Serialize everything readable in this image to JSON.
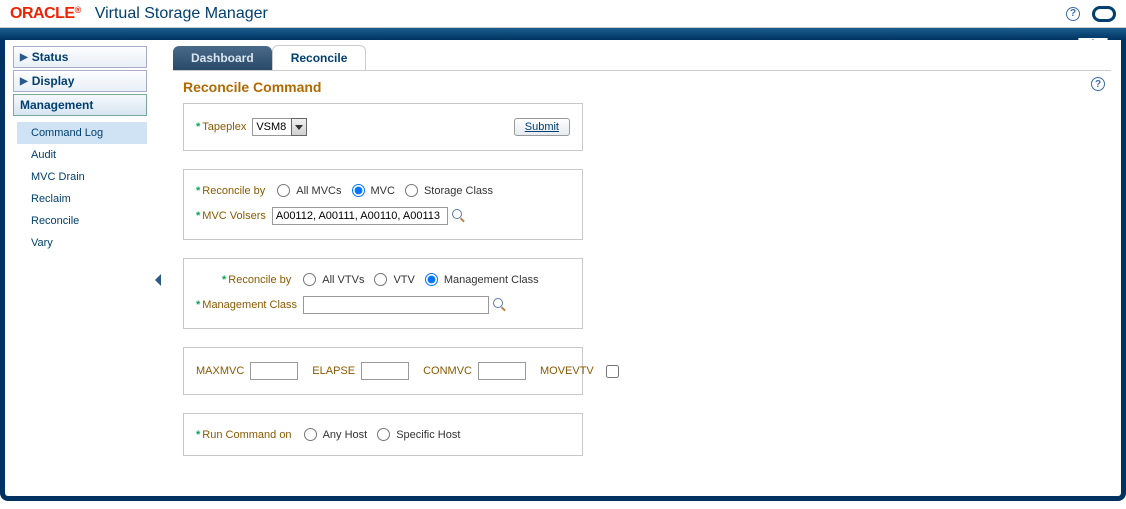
{
  "header": {
    "logo": "ORACLE",
    "app_title": "Virtual Storage Manager"
  },
  "sidebar": {
    "status": "Status",
    "display": "Display",
    "management": "Management",
    "items": [
      "Command Log",
      "Audit",
      "MVC Drain",
      "Reclaim",
      "Reconcile",
      "Vary"
    ]
  },
  "tabs": {
    "dashboard": "Dashboard",
    "reconcile": "Reconcile"
  },
  "page": {
    "title": "Reconcile Command"
  },
  "p1": {
    "tapeplex_label": "Tapeplex",
    "tapeplex_value": "VSM8",
    "submit": "Submit"
  },
  "p2": {
    "reconcile_by": "Reconcile by",
    "opt_allmvcs": "All MVCs",
    "opt_mvc": "MVC",
    "opt_storage": "Storage Class",
    "mvc_volsers_label": "MVC Volsers",
    "mvc_volsers_value": "A00112, A00111, A00110, A00113"
  },
  "p3": {
    "reconcile_by": "Reconcile by",
    "opt_allvtvs": "All VTVs",
    "opt_vtv": "VTV",
    "opt_mgmt": "Management Class",
    "mgmt_label": "Management Class",
    "mgmt_value": ""
  },
  "p4": {
    "maxmvc": "MAXMVC",
    "elapse": "ELAPSE",
    "conmvc": "CONMVC",
    "movevtv": "MOVEVTV"
  },
  "p5": {
    "runcmd": "Run Command on",
    "anyhost": "Any Host",
    "specific": "Specific Host"
  }
}
